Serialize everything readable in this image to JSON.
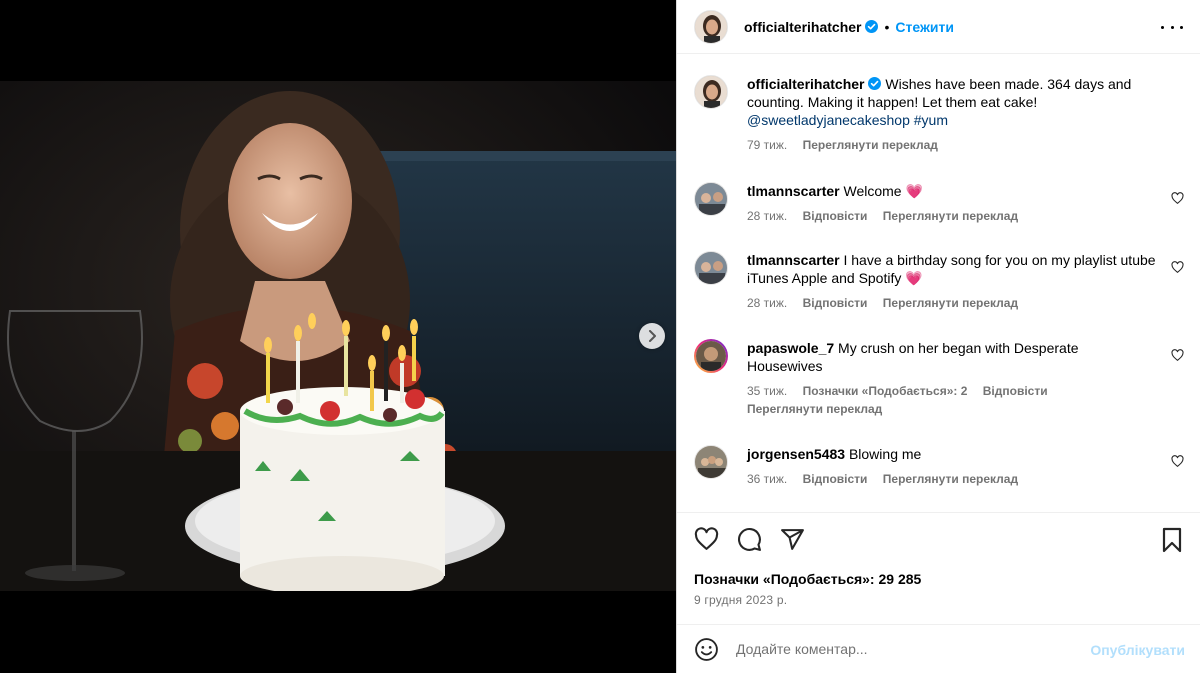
{
  "post": {
    "username": "officialterihatcher",
    "follow_label": "Стежити",
    "separator": "•",
    "caption": {
      "text": " Wishes have been made. 364 days and counting. Making it happen! Let them eat cake!",
      "mention": "@sweetladyjanecakeshop",
      "hashtag": "#yum",
      "time": "79 тиж.",
      "translate": "Переглянути переклад"
    }
  },
  "comments": [
    {
      "username": "tlmannscarter",
      "text": " Welcome ",
      "emoji": "💗",
      "time": "28 тиж.",
      "reply": "Відповісти",
      "translate": "Переглянути переклад"
    },
    {
      "username": "tlmannscarter",
      "text": " I have a birthday song for you on my playlist utube iTunes Apple and Spotify ",
      "emoji": "💗",
      "time": "28 тиж.",
      "reply": "Відповісти",
      "translate": "Переглянути переклад"
    },
    {
      "username": "papaswole_7",
      "text": " My crush on her began with Desperate Housewives",
      "time": "35 тиж.",
      "likes": "Позначки «Подобається»: 2",
      "reply": "Відповісти",
      "translate": "Переглянути переклад"
    },
    {
      "username": "jorgensen5483",
      "text": " Blowing me",
      "time": "36 тиж.",
      "reply": "Відповісти",
      "translate": "Переглянути переклад"
    }
  ],
  "actions": {
    "likes_label": "Позначки «Подобається»: 29 285",
    "date": "9 грудня 2023 р."
  },
  "comment_box": {
    "placeholder": "Додайте коментар...",
    "publish_label": "Опублікувати"
  },
  "colors": {
    "accent": "#0095f6",
    "link": "#00376b",
    "muted": "#737373",
    "publish_disabled": "#b2dffc"
  },
  "icons": [
    "next-arrow-icon",
    "verified-badge-icon",
    "more-options-icon",
    "heart-icon",
    "comment-icon",
    "share-icon",
    "bookmark-icon",
    "emoji-icon"
  ]
}
